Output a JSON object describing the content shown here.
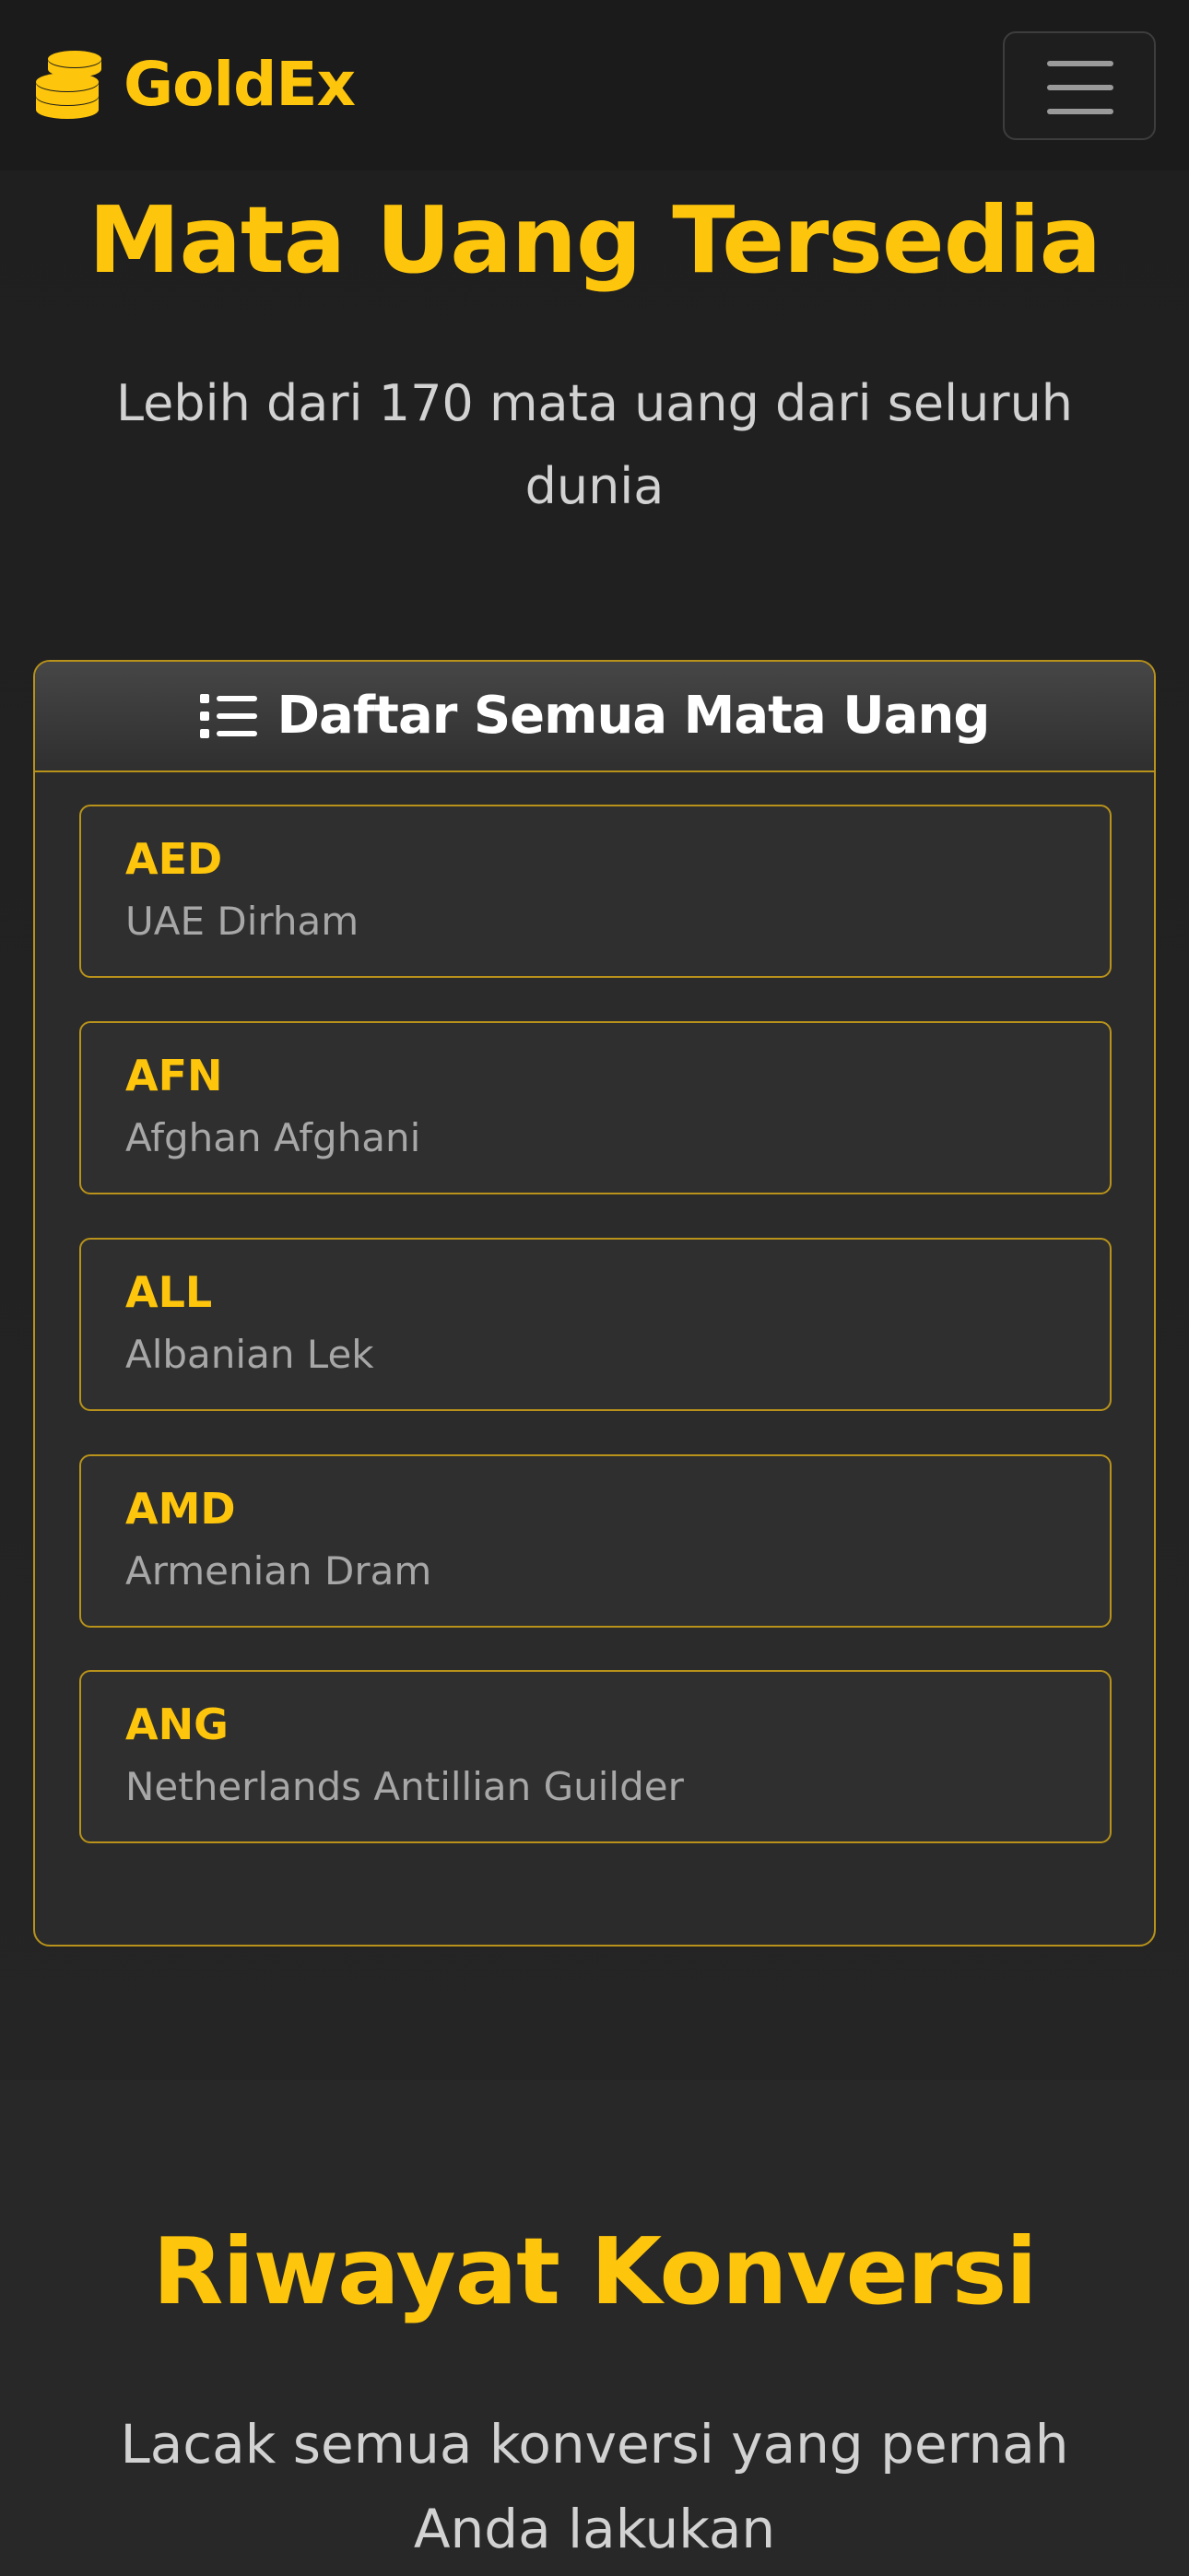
{
  "navbar": {
    "brand_name": "GoldEx",
    "brand_icon": "coins-icon",
    "menu_icon": "hamburger-menu-icon"
  },
  "currencies": {
    "title": "Mata Uang Tersedia",
    "subtitle": "Lebih dari 170 mata uang dari seluruh dunia",
    "card": {
      "title": "Daftar Semua Mata Uang",
      "icon": "list-icon",
      "items": [
        {
          "code": "AED",
          "name": "UAE Dirham"
        },
        {
          "code": "AFN",
          "name": "Afghan Afghani"
        },
        {
          "code": "ALL",
          "name": "Albanian Lek"
        },
        {
          "code": "AMD",
          "name": "Armenian Dram"
        },
        {
          "code": "ANG",
          "name": "Netherlands Antillian Guilder"
        }
      ]
    }
  },
  "history": {
    "title": "Riwayat Konversi",
    "subtitle": "Lacak semua konversi yang pernah Anda lakukan"
  },
  "colors": {
    "accent": "#fdc50b",
    "background": "#222222",
    "card_border": "#b8921a"
  }
}
